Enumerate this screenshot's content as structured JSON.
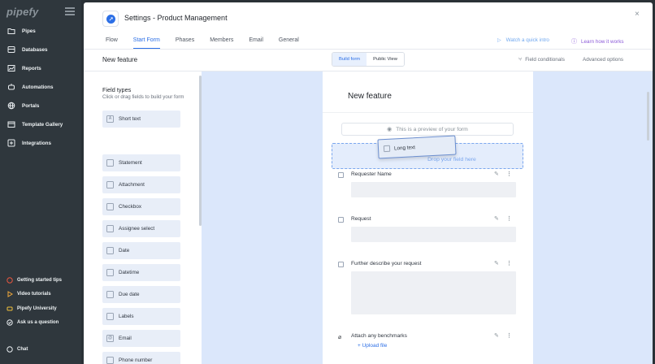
{
  "sidebar": {
    "logo": "pipefy",
    "items": [
      {
        "label": "Pipes",
        "icon": "folder-icon"
      },
      {
        "label": "Databases",
        "icon": "database-icon"
      },
      {
        "label": "Reports",
        "icon": "chart-icon"
      },
      {
        "label": "Automations",
        "icon": "robot-icon"
      },
      {
        "label": "Portals",
        "icon": "globe-icon"
      },
      {
        "label": "Template Gallery",
        "icon": "gallery-icon"
      },
      {
        "label": "Integrations",
        "icon": "plus-square-icon"
      }
    ],
    "help": [
      {
        "label": "Getting started tips",
        "color": "#e8563f"
      },
      {
        "label": "Video tutorials",
        "color": "#f2a93b"
      },
      {
        "label": "Pipefy University",
        "color": "#f2c23b"
      },
      {
        "label": "Ask us a question",
        "color": "#e9edf0"
      }
    ],
    "chat": "Chat"
  },
  "modal": {
    "title": "Settings - Product Management",
    "close": "×",
    "tabs": [
      "Flow",
      "Start Form",
      "Phases",
      "Members",
      "Email",
      "General"
    ],
    "active_tab": "Start Form",
    "watch_intro": "Watch a quick intro",
    "learn_how": "Learn how it works",
    "section_title": "New feature",
    "build_form": "Build form",
    "public_view": "Public View",
    "field_conditionals": "Field conditionals",
    "advanced_options": "Advanced options"
  },
  "field_types": {
    "title": "Field types",
    "subtitle": "Click or drag fields to build your form",
    "items": [
      "Short text",
      "Statement",
      "Attachment",
      "Checkbox",
      "Assignee select",
      "Date",
      "Datetime",
      "Due date",
      "Labels",
      "Email",
      "Phone number"
    ]
  },
  "form": {
    "title": "New feature",
    "preview_note": "This is a preview of your form",
    "drop_hint": "Drop your field here",
    "dragging": "Long text",
    "fields": [
      {
        "label": "Requester Name"
      },
      {
        "label": "Request"
      },
      {
        "label": "Further describe your request"
      },
      {
        "label": "Attach any benchmarks"
      }
    ],
    "upload_label": "Upload file"
  },
  "colors": {
    "accent": "#2c6fe6",
    "sidebar_bg": "#2f373d",
    "canvas_bg": "#dbe7fb",
    "learn": "#8b5ad8"
  }
}
